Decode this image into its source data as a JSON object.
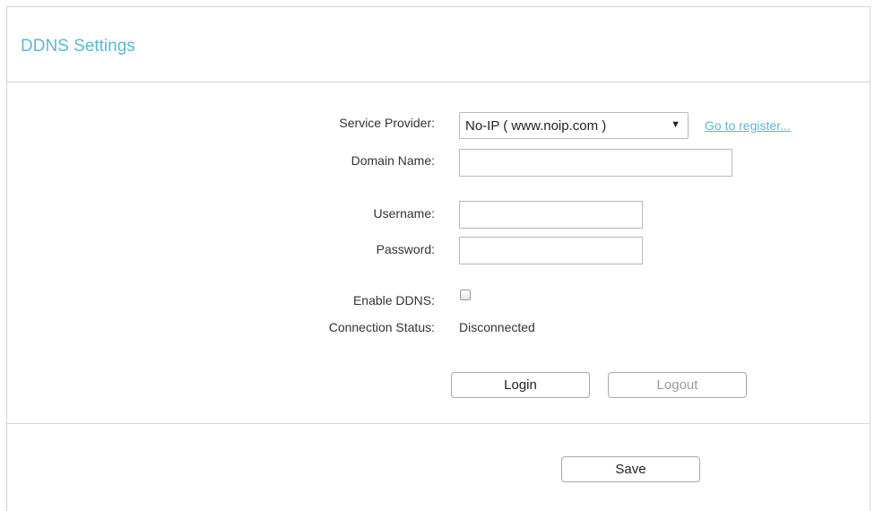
{
  "panel": {
    "title": "DDNS Settings"
  },
  "form": {
    "service_provider": {
      "label": "Service Provider:",
      "selected": "No-IP ( www.noip.com )",
      "arrow": "▼",
      "register_link": "Go to register..."
    },
    "domain_name": {
      "label": "Domain Name:",
      "value": ""
    },
    "username": {
      "label": "Username:",
      "value": ""
    },
    "password": {
      "label": "Password:",
      "value": ""
    },
    "enable_ddns": {
      "label": "Enable DDNS:",
      "checked": false
    },
    "connection_status": {
      "label": "Connection Status:",
      "value": "Disconnected"
    }
  },
  "buttons": {
    "login": "Login",
    "logout": "Logout",
    "save": "Save"
  },
  "colors": {
    "accent": "#5bb8cf",
    "border": "#d6d6d6",
    "disabled_text": "#9a9a9a"
  }
}
